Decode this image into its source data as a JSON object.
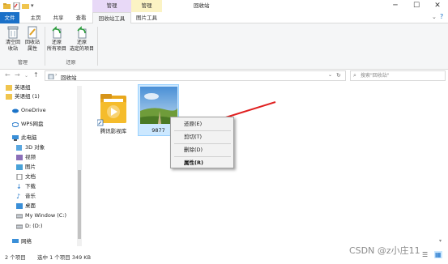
{
  "window": {
    "title": "回收站",
    "context_groups": [
      {
        "label": "管理",
        "color": "#e8d9f7"
      },
      {
        "label": "管理",
        "color": "#fbf3c4"
      }
    ]
  },
  "ribbon_tabs": [
    "文件",
    "主页",
    "共享",
    "查看",
    "回收站工具",
    "图片工具"
  ],
  "ribbon": {
    "buttons": [
      {
        "label_1": "清空回",
        "label_2": "收站",
        "icon": "empty-recycle-bin-icon"
      },
      {
        "label_1": "回收站",
        "label_2": "属性",
        "icon": "recycle-bin-properties-icon"
      },
      {
        "label_1": "还原",
        "label_2": "所有项目",
        "icon": "restore-all-icon"
      },
      {
        "label_1": "还原",
        "label_2": "选定的项目",
        "icon": "restore-selected-icon"
      }
    ],
    "groups": [
      "管理",
      "还原"
    ]
  },
  "address": {
    "path": "回收站",
    "search_placeholder": "搜索\"回收站\""
  },
  "nav_pane": {
    "items": [
      "英语组",
      "英语组 (1)",
      "OneDrive",
      "WPS网盘",
      "此电脑",
      "3D 对象",
      "视频",
      "图片",
      "文档",
      "下载",
      "音乐",
      "桌面",
      "My Window (C:)",
      "D: (D:)",
      "网络"
    ]
  },
  "files": [
    {
      "name": "腾讯影视库",
      "icon": "folder-video-icon"
    },
    {
      "name": "9877",
      "icon": "landscape-image-icon"
    }
  ],
  "context_menu": {
    "items": [
      "还原(E)",
      "剪切(T)",
      "删除(D)",
      "属性(R)"
    ]
  },
  "status": {
    "count": "2 个项目",
    "selection": "选中 1 个项目  349 KB"
  },
  "watermark": "CSDN @z小庄11",
  "colors": {
    "accent": "#1a70c8",
    "selection": "#cce8ff",
    "arrow": "#e02020"
  }
}
